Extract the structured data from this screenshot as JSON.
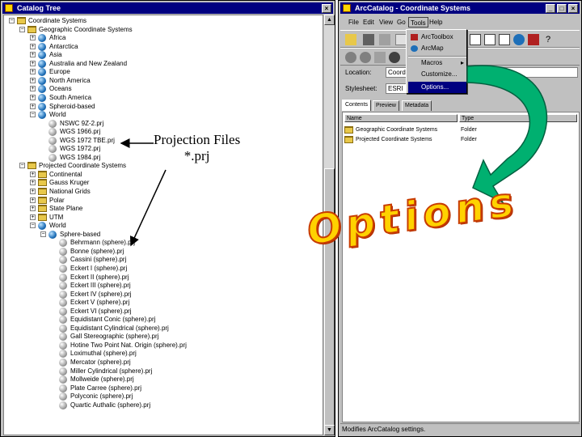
{
  "catalog": {
    "title": "Catalog Tree",
    "tree": [
      {
        "label": "Coordinate Systems",
        "depth": 0,
        "icon": "folder",
        "expander": "minus"
      },
      {
        "label": "Geographic Coordinate Systems",
        "depth": 1,
        "icon": "folder",
        "expander": "minus"
      },
      {
        "label": "Africa",
        "depth": 2,
        "icon": "globe",
        "expander": "plus"
      },
      {
        "label": "Antarctica",
        "depth": 2,
        "icon": "globe",
        "expander": "plus"
      },
      {
        "label": "Asia",
        "depth": 2,
        "icon": "globe",
        "expander": "plus"
      },
      {
        "label": "Australia and New Zealand",
        "depth": 2,
        "icon": "globe",
        "expander": "plus"
      },
      {
        "label": "Europe",
        "depth": 2,
        "icon": "globe",
        "expander": "plus"
      },
      {
        "label": "North America",
        "depth": 2,
        "icon": "globe",
        "expander": "plus"
      },
      {
        "label": "Oceans",
        "depth": 2,
        "icon": "globe",
        "expander": "plus"
      },
      {
        "label": "South America",
        "depth": 2,
        "icon": "globe",
        "expander": "plus"
      },
      {
        "label": "Spheroid-based",
        "depth": 2,
        "icon": "globe",
        "expander": "plus"
      },
      {
        "label": "World",
        "depth": 2,
        "icon": "globe",
        "expander": "minus"
      },
      {
        "label": "NSWC 9Z-2.prj",
        "depth": 3,
        "icon": "prj",
        "expander": ""
      },
      {
        "label": "WGS 1966.prj",
        "depth": 3,
        "icon": "prj",
        "expander": ""
      },
      {
        "label": "WGS 1972 TBE.prj",
        "depth": 3,
        "icon": "prj",
        "expander": ""
      },
      {
        "label": "WGS 1972.prj",
        "depth": 3,
        "icon": "prj",
        "expander": ""
      },
      {
        "label": "WGS 1984.prj",
        "depth": 3,
        "icon": "prj",
        "expander": ""
      },
      {
        "label": "Projected Coordinate Systems",
        "depth": 1,
        "icon": "folder",
        "expander": "minus"
      },
      {
        "label": "Continental",
        "depth": 2,
        "icon": "folder",
        "expander": "plus"
      },
      {
        "label": "Gauss Kruger",
        "depth": 2,
        "icon": "folder",
        "expander": "plus"
      },
      {
        "label": "National Grids",
        "depth": 2,
        "icon": "folder",
        "expander": "plus"
      },
      {
        "label": "Polar",
        "depth": 2,
        "icon": "folder",
        "expander": "plus"
      },
      {
        "label": "State Plane",
        "depth": 2,
        "icon": "folder",
        "expander": "plus"
      },
      {
        "label": "UTM",
        "depth": 2,
        "icon": "folder",
        "expander": "plus"
      },
      {
        "label": "World",
        "depth": 2,
        "icon": "globe",
        "expander": "minus"
      },
      {
        "label": "Sphere-based",
        "depth": 3,
        "icon": "globe",
        "expander": "minus"
      },
      {
        "label": "Behrmann (sphere).prj",
        "depth": 4,
        "icon": "prj",
        "expander": ""
      },
      {
        "label": "Bonne (sphere).prj",
        "depth": 4,
        "icon": "prj",
        "expander": ""
      },
      {
        "label": "Cassini (sphere).prj",
        "depth": 4,
        "icon": "prj",
        "expander": ""
      },
      {
        "label": "Eckert I (sphere).prj",
        "depth": 4,
        "icon": "prj",
        "expander": ""
      },
      {
        "label": "Eckert II (sphere).prj",
        "depth": 4,
        "icon": "prj",
        "expander": ""
      },
      {
        "label": "Eckert III (sphere).prj",
        "depth": 4,
        "icon": "prj",
        "expander": ""
      },
      {
        "label": "Eckert IV (sphere).prj",
        "depth": 4,
        "icon": "prj",
        "expander": ""
      },
      {
        "label": "Eckert V (sphere).prj",
        "depth": 4,
        "icon": "prj",
        "expander": ""
      },
      {
        "label": "Eckert VI (sphere).prj",
        "depth": 4,
        "icon": "prj",
        "expander": ""
      },
      {
        "label": "Equidistant Conic (sphere).prj",
        "depth": 4,
        "icon": "prj",
        "expander": ""
      },
      {
        "label": "Equidistant Cylindrical (sphere).prj",
        "depth": 4,
        "icon": "prj",
        "expander": ""
      },
      {
        "label": "Gall Stereographic (sphere).prj",
        "depth": 4,
        "icon": "prj",
        "expander": ""
      },
      {
        "label": "Hotine Two Point Nat. Origin (sphere).prj",
        "depth": 4,
        "icon": "prj",
        "expander": ""
      },
      {
        "label": "Loximuthal (sphere).prj",
        "depth": 4,
        "icon": "prj",
        "expander": ""
      },
      {
        "label": "Mercator (sphere).prj",
        "depth": 4,
        "icon": "prj",
        "expander": ""
      },
      {
        "label": "Miller Cylindrical (sphere).prj",
        "depth": 4,
        "icon": "prj",
        "expander": ""
      },
      {
        "label": "Mollweide (sphere).prj",
        "depth": 4,
        "icon": "prj",
        "expander": ""
      },
      {
        "label": "Plate Carree (sphere).prj",
        "depth": 4,
        "icon": "prj",
        "expander": ""
      },
      {
        "label": "Polyconic (sphere).prj",
        "depth": 4,
        "icon": "prj",
        "expander": ""
      },
      {
        "label": "Quartic Authalic (sphere).prj",
        "depth": 4,
        "icon": "prj",
        "expander": ""
      }
    ]
  },
  "arccatalog": {
    "title": "ArcCatalog - Coordinate Systems",
    "menus": [
      "File",
      "Edit",
      "View",
      "Go",
      "Tools",
      "Help"
    ],
    "tools_menu": [
      "ArcToolbox",
      "ArcMap",
      "Macros",
      "Customize...",
      "Options..."
    ],
    "location_label": "Location:",
    "location_value": "Coordinate Systems",
    "stylesheet_label": "Stylesheet:",
    "stylesheet_value": "ESRI",
    "tabs": [
      "Contents",
      "Preview",
      "Metadata"
    ],
    "columns": [
      "Name",
      "Type"
    ],
    "rows": [
      {
        "name": "Geographic Coordinate Systems",
        "type": "Folder"
      },
      {
        "name": "Projected Coordinate Systems",
        "type": "Folder"
      }
    ],
    "status": "Modifies ArcCatalog settings."
  },
  "annotations": {
    "projection_line1": "Projection Files",
    "projection_line2": "*.prj",
    "options_big": "Options"
  },
  "colors": {
    "titlebar": "#000080",
    "arrow_green": "#00b070",
    "options_text": "#ffd200"
  }
}
